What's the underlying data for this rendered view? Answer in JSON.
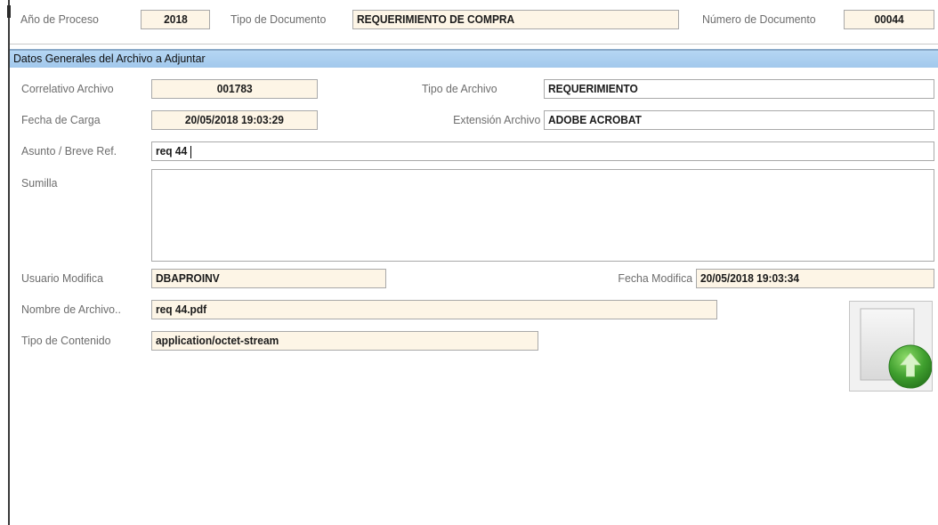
{
  "header": {
    "anio_label": "Año de Proceso",
    "anio_value": "2018",
    "tipo_doc_label": "Tipo de Documento",
    "tipo_doc_value": "REQUERIMIENTO DE COMPRA",
    "num_doc_label": "Número de Documento",
    "num_doc_value": "00044"
  },
  "section": {
    "title": "Datos Generales del Archivo a Adjuntar"
  },
  "form": {
    "correlativo_label": "Correlativo Archivo",
    "correlativo_value": "001783",
    "tipo_archivo_label": "Tipo de Archivo",
    "tipo_archivo_value": "REQUERIMIENTO",
    "fecha_carga_label": "Fecha de Carga",
    "fecha_carga_value": "20/05/2018 19:03:29",
    "extension_label": "Extensión Archivo",
    "extension_value": "ADOBE ACROBAT",
    "asunto_label": "Asunto / Breve Ref.",
    "asunto_value": "req 44",
    "sumilla_label": "Sumilla",
    "sumilla_value": "",
    "usuario_label": "Usuario Modifica",
    "usuario_value": "DBAPROINV",
    "fecha_mod_label": "Fecha Modifica",
    "fecha_mod_value": "20/05/2018 19:03:34",
    "nombre_label": "Nombre de Archivo..",
    "nombre_value": "req 44.pdf",
    "contenido_label": "Tipo de Contenido",
    "contenido_value": "application/octet-stream"
  },
  "icons": {
    "upload": "upload-file-icon"
  },
  "colors": {
    "field_bg": "#fdf5e6",
    "section_bg": "#a9cdee",
    "upload_green": "#3f9f2e"
  }
}
